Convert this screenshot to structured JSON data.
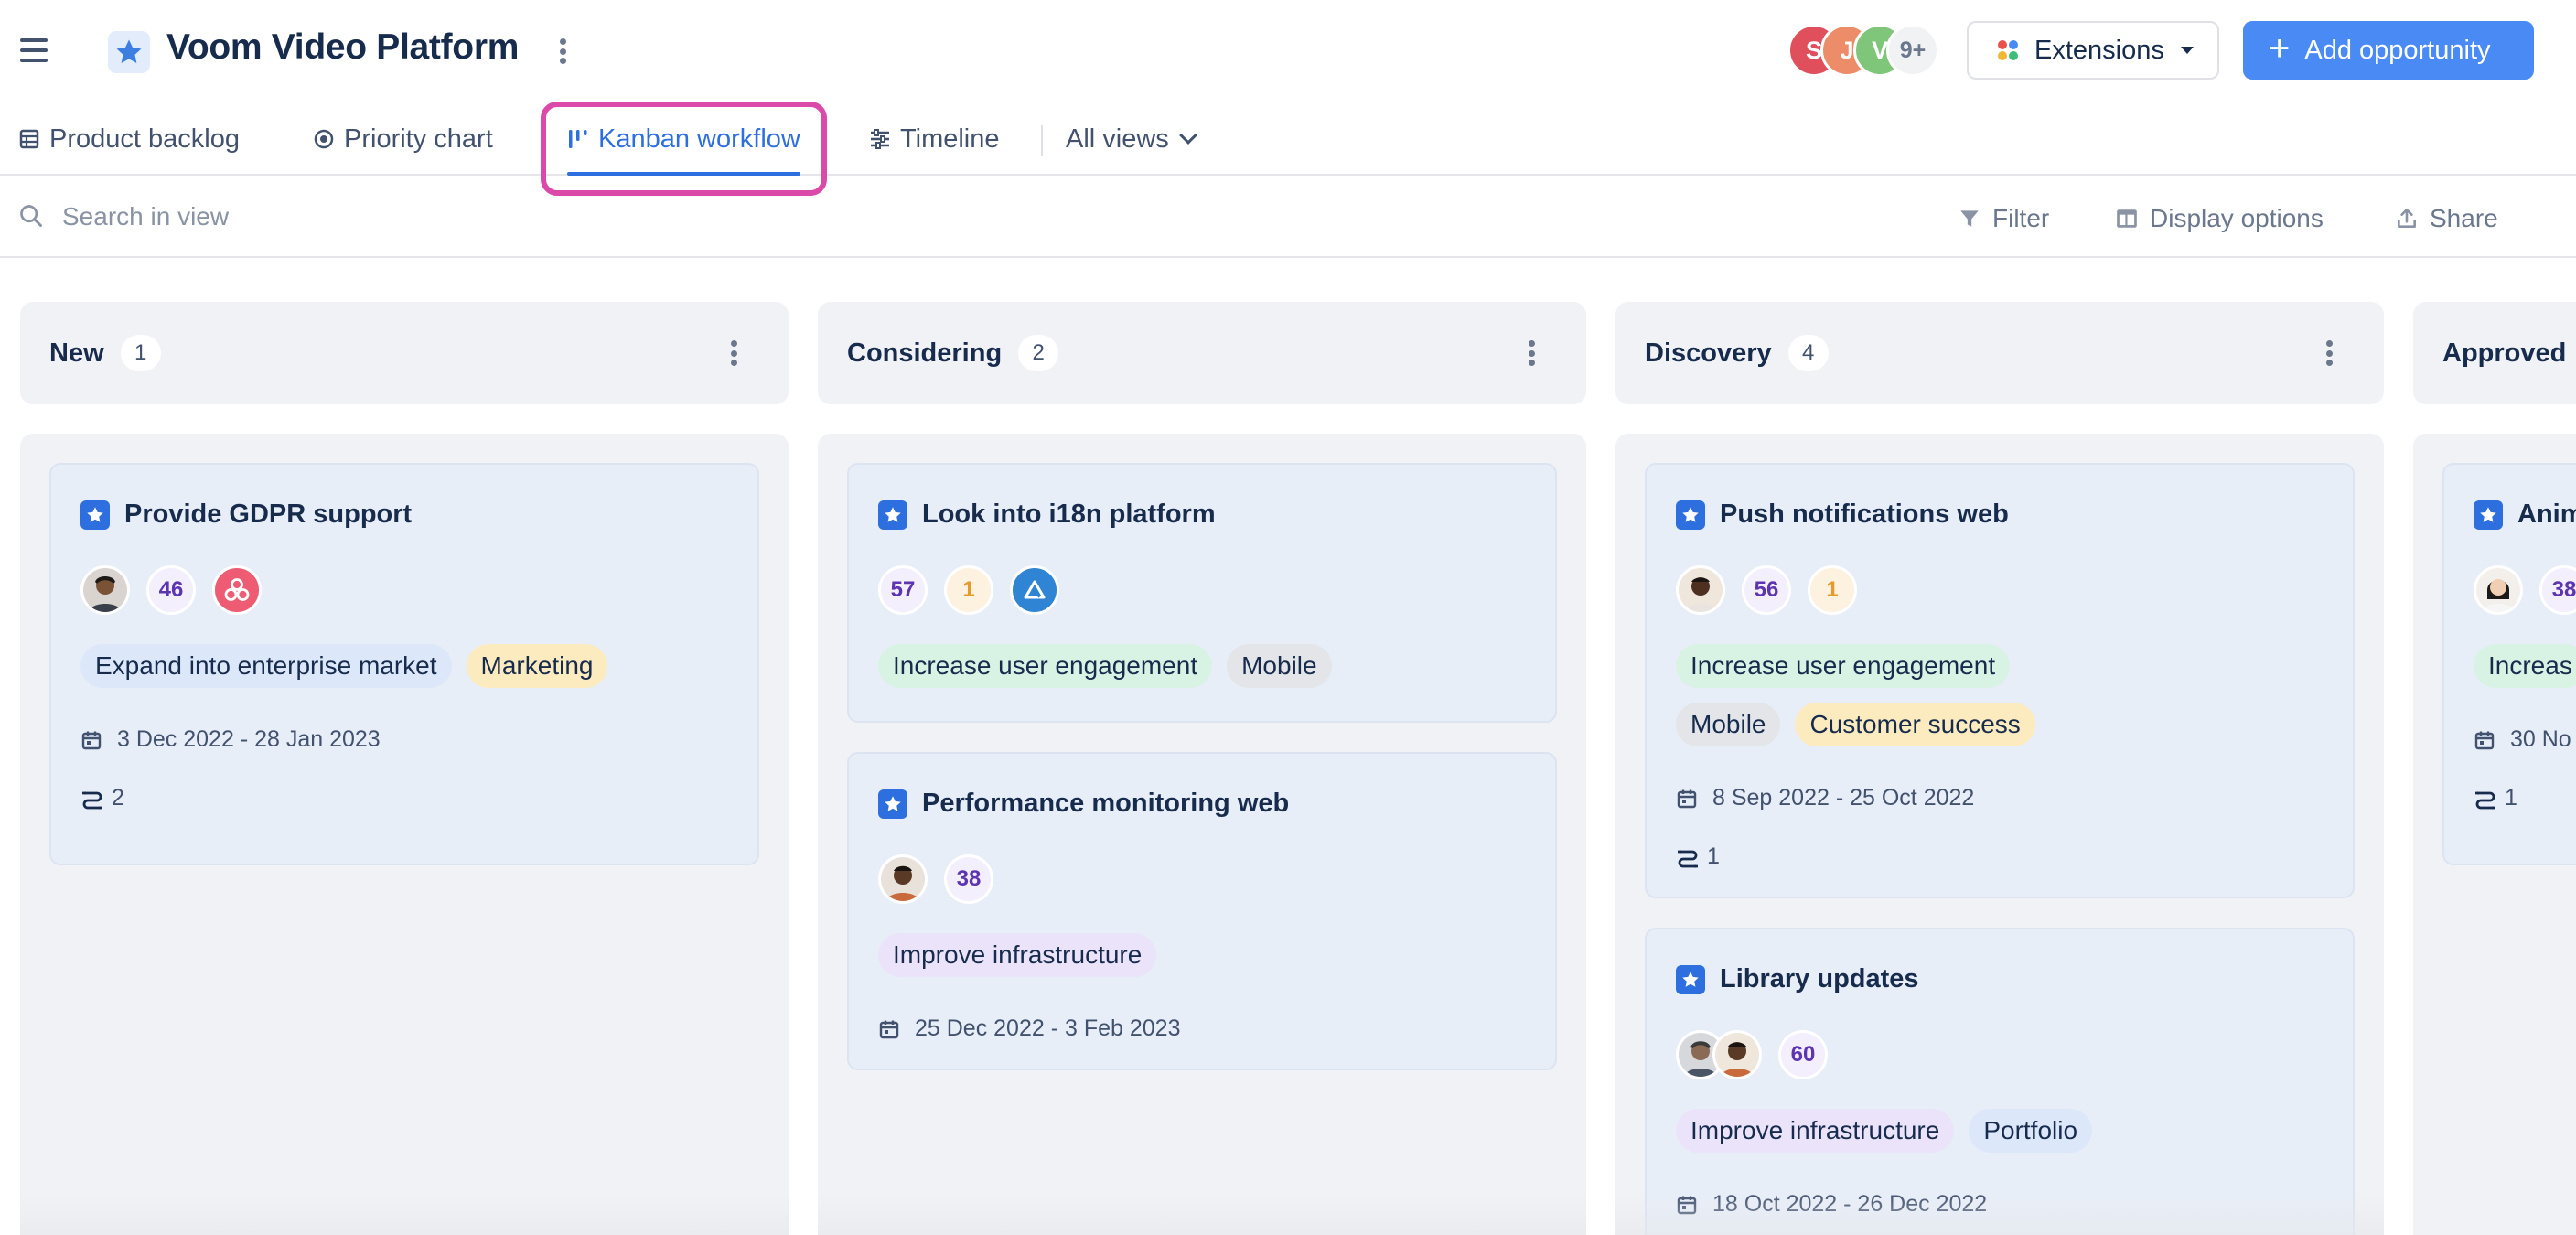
{
  "header": {
    "title": "Voom Video Platform",
    "avatars": [
      {
        "initial": "S",
        "color": "#e0505c"
      },
      {
        "initial": "J",
        "color": "#ec8c68"
      },
      {
        "initial": "V",
        "color": "#7fc57a"
      }
    ],
    "avatars_more": "9+",
    "extensions_label": "Extensions",
    "add_label": "Add opportunity"
  },
  "tabs": [
    {
      "label": "Product backlog",
      "icon": "table-icon"
    },
    {
      "label": "Priority chart",
      "icon": "target-icon"
    },
    {
      "label": "Kanban workflow",
      "icon": "kanban-icon",
      "active": true
    },
    {
      "label": "Timeline",
      "icon": "timeline-icon"
    }
  ],
  "all_views_label": "All views",
  "toolbar": {
    "search_placeholder": "Search in view",
    "filter_label": "Filter",
    "display_label": "Display options",
    "share_label": "Share"
  },
  "columns": [
    {
      "name": "New",
      "count": "1",
      "cards": [
        {
          "title": "Provide GDPR support",
          "score": "46",
          "tags": [
            "Expand into enterprise market",
            "Marketing"
          ],
          "dates": "3 Dec 2022 - 28 Jan 2023",
          "links": "2"
        }
      ]
    },
    {
      "name": "Considering",
      "count": "2",
      "cards": [
        {
          "title": "Look into i18n platform",
          "score": "57",
          "votes": "1",
          "tags": [
            "Increase user engagement",
            "Mobile"
          ]
        },
        {
          "title": "Performance monitoring web",
          "score": "38",
          "tags": [
            "Improve infrastructure"
          ],
          "dates": "25 Dec 2022 - 3 Feb 2023"
        }
      ]
    },
    {
      "name": "Discovery",
      "count": "4",
      "cards": [
        {
          "title": "Push notifications web",
          "score": "56",
          "votes": "1",
          "tags": [
            "Increase user engagement",
            "Mobile",
            "Customer success"
          ],
          "dates": "8 Sep 2022 - 25 Oct 2022",
          "links": "1"
        },
        {
          "title": "Library updates",
          "score": "60",
          "tags": [
            "Improve infrastructure",
            "Portfolio"
          ],
          "dates": "18 Oct 2022 - 26 Dec 2022"
        }
      ]
    },
    {
      "name": "Approved",
      "count": "",
      "cards": [
        {
          "title": "Anim",
          "score": "38",
          "tags": [
            "Increas"
          ],
          "dates": "30 No",
          "links": "1"
        }
      ]
    }
  ],
  "colors": {
    "accent": "#2d6fde",
    "primary_button": "#4a8af4",
    "highlight": "#db4aa8",
    "column_bg": "#f1f2f5",
    "card_bg": "#e8eef8"
  }
}
